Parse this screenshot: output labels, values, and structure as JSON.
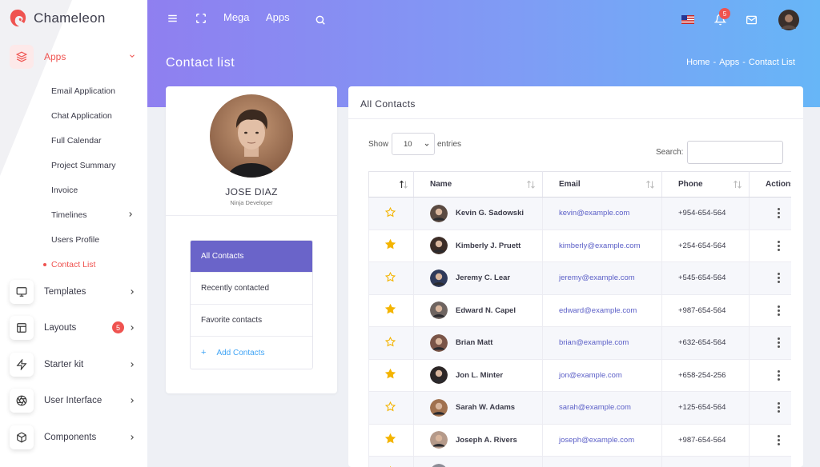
{
  "brand": {
    "name": "Chameleon",
    "accent": "#ef5350"
  },
  "sidebar": {
    "apps_label": "Apps",
    "apps_items": [
      {
        "label": "Email Application"
      },
      {
        "label": "Chat Application"
      },
      {
        "label": "Full Calendar"
      },
      {
        "label": "Project Summary"
      },
      {
        "label": "Invoice"
      },
      {
        "label": "Timelines"
      },
      {
        "label": "Users Profile"
      },
      {
        "label": "Contact List"
      }
    ],
    "groups": [
      {
        "label": "Templates",
        "icon": "monitor-icon"
      },
      {
        "label": "Layouts",
        "icon": "layout-icon",
        "badge": "5"
      },
      {
        "label": "Starter kit",
        "icon": "bolt-icon"
      },
      {
        "label": "User Interface",
        "icon": "aperture-icon"
      },
      {
        "label": "Components",
        "icon": "box-icon"
      }
    ]
  },
  "topbar": {
    "mega_label": "Mega",
    "apps_label": "Apps",
    "notification_count": "5"
  },
  "page": {
    "title": "Contact list",
    "breadcrumb": [
      "Home",
      "-",
      "Apps",
      "-",
      "Contact List"
    ]
  },
  "profile": {
    "name": "JOSE DIAZ",
    "role": "Ninja Developer",
    "menu": [
      {
        "label": "All Contacts"
      },
      {
        "label": "Recently contacted"
      },
      {
        "label": "Favorite contacts"
      },
      {
        "label": "Add Contacts",
        "prefix": "+"
      }
    ]
  },
  "contacts": {
    "title": "All Contacts",
    "show_label": "Show",
    "entries_value": "10",
    "entries_label": "entries",
    "search_label": "Search:",
    "columns": [
      "",
      "Name",
      "Email",
      "Phone",
      "Actions"
    ],
    "rows": [
      {
        "starred": false,
        "name": "Kevin G. Sadowski",
        "email": "kevin@example.com",
        "phone": "+954-654-564",
        "avatar_color": "#5a4a42"
      },
      {
        "starred": true,
        "name": "Kimberly J. Pruett",
        "email": "kimberly@example.com",
        "phone": "+254-654-564",
        "avatar_color": "#3c2c26"
      },
      {
        "starred": false,
        "name": "Jeremy C. Lear",
        "email": "jeremy@example.com",
        "phone": "+545-654-564",
        "avatar_color": "#2f3a5a"
      },
      {
        "starred": true,
        "name": "Edward N. Capel",
        "email": "edward@example.com",
        "phone": "+987-654-564",
        "avatar_color": "#6e6460"
      },
      {
        "starred": false,
        "name": "Brian Matt",
        "email": "brian@example.com",
        "phone": "+632-654-564",
        "avatar_color": "#7a5548"
      },
      {
        "starred": true,
        "name": "Jon L. Minter",
        "email": "jon@example.com",
        "phone": "+658-254-256",
        "avatar_color": "#2c2626"
      },
      {
        "starred": false,
        "name": "Sarah W. Adams",
        "email": "sarah@example.com",
        "phone": "+125-654-564",
        "avatar_color": "#a0714f"
      },
      {
        "starred": true,
        "name": "Joseph A. Rivers",
        "email": "joseph@example.com",
        "phone": "+987-654-564",
        "avatar_color": "#b59a8a"
      },
      {
        "starred": false,
        "name": "",
        "email": "",
        "phone": "",
        "avatar_color": "#8c8c96"
      }
    ]
  },
  "colors": {
    "star": "#f4b400",
    "header_start": "#8f7ff0",
    "header_end": "#67b6f7",
    "active_menu": "#6a64c9",
    "link": "#5b5fc7"
  }
}
